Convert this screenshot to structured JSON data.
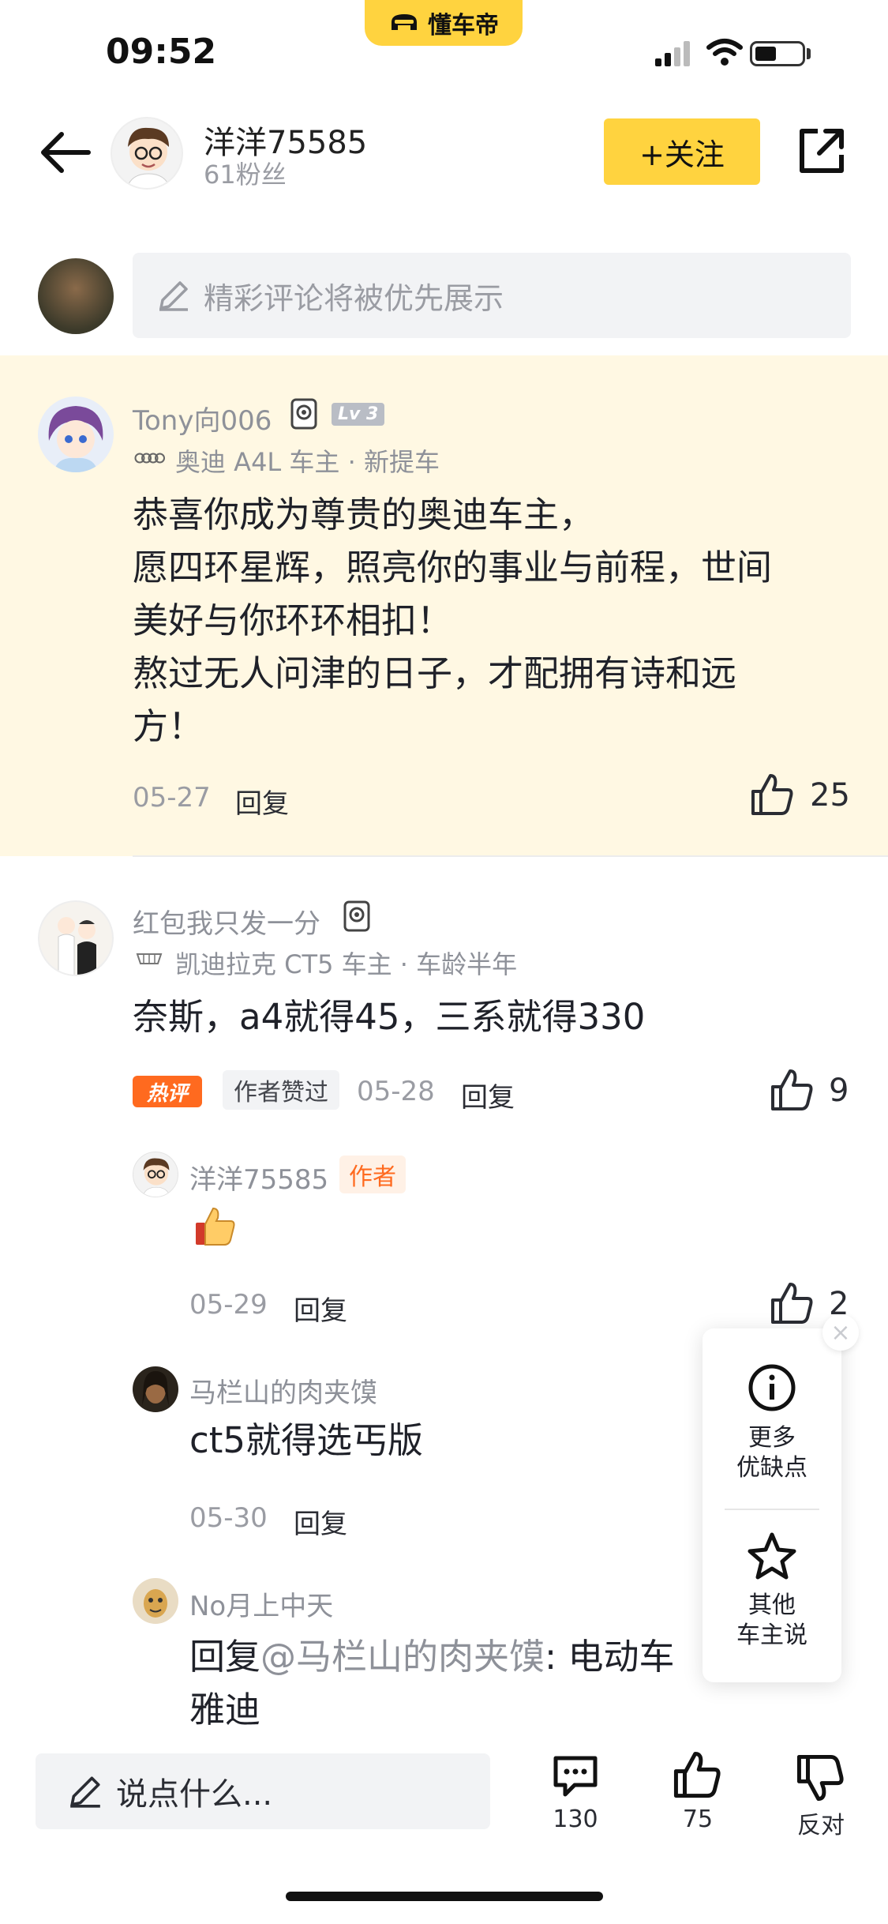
{
  "status_bar": {
    "time": "09:52",
    "brand": "懂车帝"
  },
  "header": {
    "author_name": "洋洋75585",
    "fans": "61粉丝",
    "follow_label": "+关注"
  },
  "comment_input": {
    "placeholder": "精彩评论将被优先展示"
  },
  "comments": [
    {
      "user": "Tony向006",
      "level": "Lv 3",
      "car": "奥迪 A4L 车主 · 新提车",
      "lines": [
        "恭喜你成为尊贵的奥迪车主，",
        "愿四环星辉，照亮你的事业与前程，世间",
        "美好与你环环相扣！",
        "熬过无人问津的日子，才配拥有诗和远",
        "方！"
      ],
      "date": "05-27",
      "reply": "回复",
      "likes": "25"
    },
    {
      "user": "红包我只发一分",
      "car": "凯迪拉克 CT5 车主 · 车龄半年",
      "text": "奈斯，a4就得45，三系就得330",
      "tag_hot": "热评",
      "tag_liked": "作者赞过",
      "date": "05-28",
      "reply": "回复",
      "likes": "9"
    }
  ],
  "replies": [
    {
      "user": "洋洋75585",
      "tag": "作者",
      "text": "👍",
      "date": "05-29",
      "reply": "回复",
      "likes": "2"
    },
    {
      "user": "马栏山的肉夹馍",
      "text": "ct5就得选丐版",
      "date": "05-30",
      "reply": "回复"
    },
    {
      "user": "No月上中天",
      "prefix": "回复",
      "mention": "@马栏山的肉夹馍",
      "text": ": 电动车",
      "text2": "雅迪"
    }
  ],
  "float_panel": {
    "item1": "更多\n优缺点",
    "item1_a": "更多",
    "item1_b": "优缺点",
    "item2_a": "其他",
    "item2_b": "车主说"
  },
  "bottom_bar": {
    "say_placeholder": "说点什么...",
    "comments_count": "130",
    "likes_count": "75",
    "oppose_label": "反对"
  }
}
